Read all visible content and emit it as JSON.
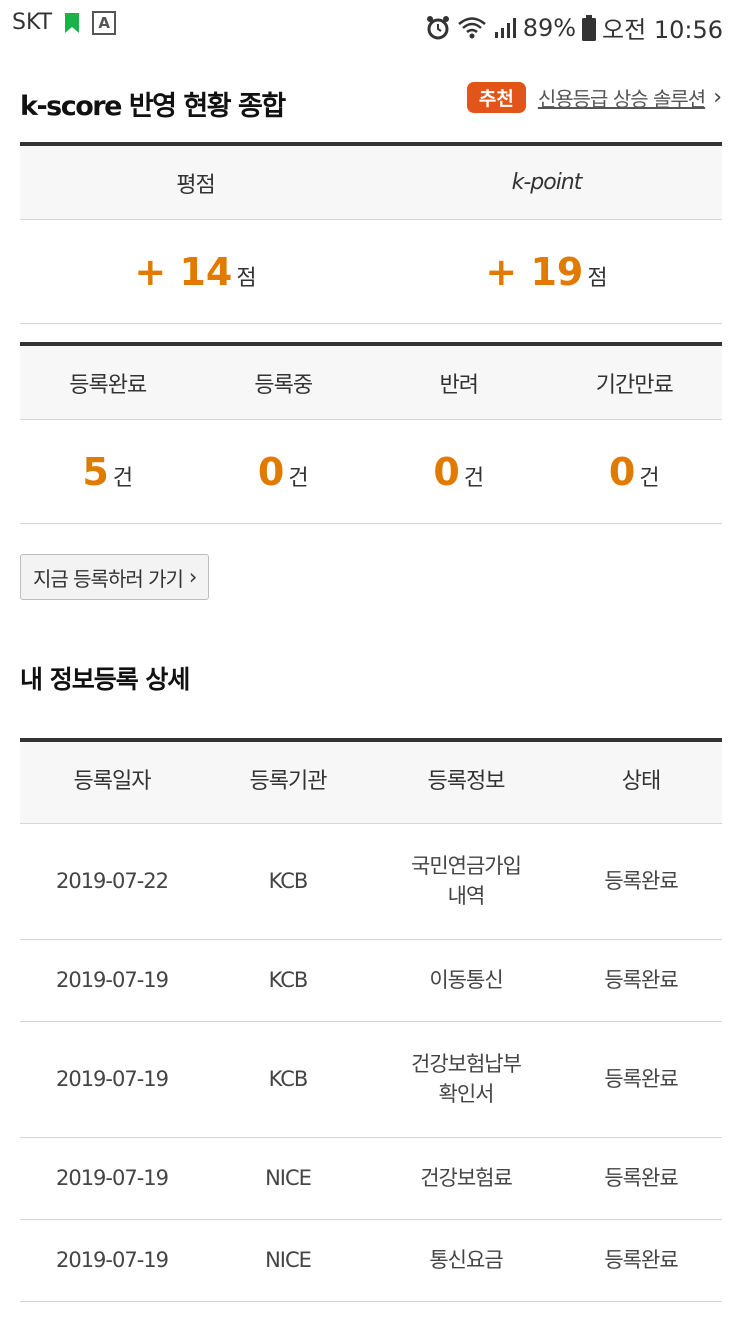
{
  "status_bar": {
    "carrier": "SKT",
    "battery": "89%",
    "time": "오전 10:56",
    "icons": [
      "bookmark-icon",
      "a-icon",
      "alarm-icon",
      "wifi-icon",
      "signal-icon",
      "battery-icon"
    ],
    "bookmark_color": "#19b34a"
  },
  "header": {
    "title": "k-score 반영 현황 종합",
    "badge": "추천",
    "link": "신용등급 상승 솔루션",
    "chevron": "›"
  },
  "scores": {
    "headers": [
      "평점",
      "k-point"
    ],
    "values": [
      {
        "num": "+ 14",
        "unit": "점"
      },
      {
        "num": "+ 19",
        "unit": "점"
      }
    ]
  },
  "counts": {
    "headers": [
      "등록완료",
      "등록중",
      "반려",
      "기간만료"
    ],
    "values": [
      {
        "num": "5",
        "unit": "건"
      },
      {
        "num": "0",
        "unit": "건"
      },
      {
        "num": "0",
        "unit": "건"
      },
      {
        "num": "0",
        "unit": "건"
      }
    ]
  },
  "register_button": {
    "label": "지금 등록하러 가기",
    "chevron": "›"
  },
  "detail": {
    "title": "내 정보등록 상세",
    "columns": [
      "등록일자",
      "등록기관",
      "등록정보",
      "상태"
    ],
    "rows": [
      {
        "date": "2019-07-22",
        "org": "KCB",
        "info_lines": [
          "국민연금가입",
          "내역"
        ],
        "status": "등록완료"
      },
      {
        "date": "2019-07-19",
        "org": "KCB",
        "info_lines": [
          "이동통신",
          ""
        ],
        "status": "등록완료"
      },
      {
        "date": "2019-07-19",
        "org": "KCB",
        "info_lines": [
          "건강보험납부",
          "확인서"
        ],
        "status": "등록완료"
      },
      {
        "date": "2019-07-19",
        "org": "NICE",
        "info_lines": [
          "건강보험료",
          ""
        ],
        "status": "등록완료"
      },
      {
        "date": "2019-07-19",
        "org": "NICE",
        "info_lines": [
          "통신요금",
          ""
        ],
        "status": "등록완료"
      }
    ]
  },
  "colors": {
    "accent": "#e07b00",
    "badge": "#e2551a",
    "border": "#333333"
  }
}
